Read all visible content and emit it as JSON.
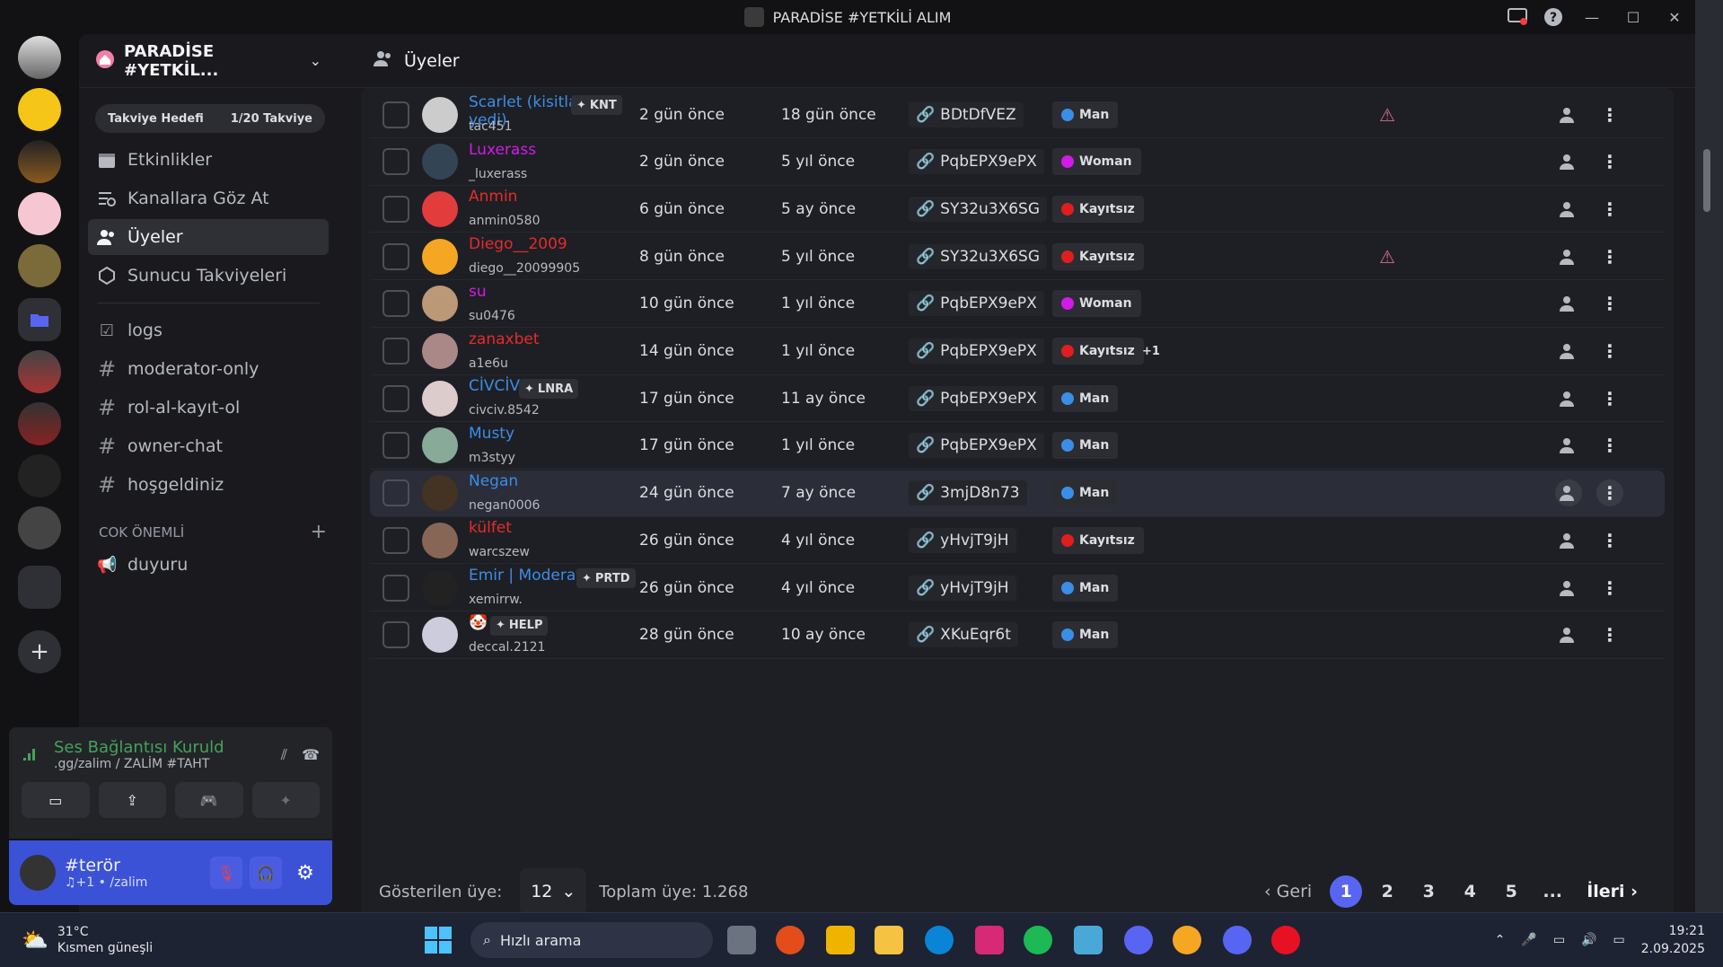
{
  "window": {
    "title": "PARADİSE #YETKİLİ ALIM"
  },
  "server": {
    "name": "PARADİSE #YETKİL...",
    "boost_label": "Takviye Hedefi",
    "boost_count": "1/20 Takviye"
  },
  "nav": [
    {
      "label": "Etkinlikler",
      "icon": "calendar-icon"
    },
    {
      "label": "Kanallara Göz At",
      "icon": "browse-channels-icon"
    },
    {
      "label": "Üyeler",
      "icon": "members-icon"
    },
    {
      "label": "Sunucu Takviyeleri",
      "icon": "boost-icon"
    }
  ],
  "channels": [
    "logs",
    "moderator-only",
    "rol-al-kayıt-ol",
    "owner-chat",
    "hoşgeldiniz"
  ],
  "category": {
    "name": "COK ÖNEMLİ",
    "channels": [
      "duyuru"
    ]
  },
  "voice": {
    "status": "Ses Bağlantısı Kuruld",
    "server": ".gg/zalim / ZALİM #TAHT"
  },
  "user": {
    "name": "#terör",
    "status": "♫+1 • /zalim"
  },
  "main": {
    "title": "Üyeler"
  },
  "members": [
    {
      "name": "Scarlet (kisitlama yedi)",
      "username": "tac451",
      "tag": "KNT",
      "joined": "2 gün önce",
      "created": "18 gün önce",
      "invite": "BDtDfVEZ",
      "role": "Man",
      "role_color": "#3b8ee6",
      "name_color": "#3b8ee6",
      "flag": true
    },
    {
      "name": "Luxerass",
      "username": "_luxerass",
      "tag": "",
      "joined": "2 gün önce",
      "created": "5 yıl önce",
      "invite": "PqbEPX9ePX",
      "role": "Woman",
      "role_color": "#d11be6",
      "name_color": "#d11be6",
      "flag": false
    },
    {
      "name": "Anmin",
      "username": "anmin0580",
      "tag": "",
      "joined": "6 gün önce",
      "created": "5 ay önce",
      "invite": "SY32u3X6SG",
      "role": "Kayıtsız",
      "role_color": "#e01e1e",
      "name_color": "#e52b2b",
      "flag": false
    },
    {
      "name": "Diego__2009",
      "username": "diego__20099905",
      "tag": "",
      "joined": "8 gün önce",
      "created": "5 yıl önce",
      "invite": "SY32u3X6SG",
      "role": "Kayıtsız",
      "role_color": "#e01e1e",
      "name_color": "#e52b2b",
      "flag": true
    },
    {
      "name": "su",
      "username": "su0476",
      "tag": "",
      "joined": "10 gün önce",
      "created": "1 yıl önce",
      "invite": "PqbEPX9ePX",
      "role": "Woman",
      "role_color": "#d11be6",
      "name_color": "#d11be6",
      "flag": false
    },
    {
      "name": "zanaxbet",
      "username": "a1e6u",
      "tag": "",
      "joined": "14 gün önce",
      "created": "1 yıl önce",
      "invite": "PqbEPX9ePX",
      "role": "Kayıtsız",
      "role_color": "#e01e1e",
      "name_color": "#e52b2b",
      "flag": false,
      "extra": "+1"
    },
    {
      "name": "CİVCİV",
      "username": "civciv.8542",
      "tag": "LNRA",
      "joined": "17 gün önce",
      "created": "11 ay önce",
      "invite": "PqbEPX9ePX",
      "role": "Man",
      "role_color": "#3b8ee6",
      "name_color": "#3b8ee6",
      "flag": false
    },
    {
      "name": "Musty",
      "username": "m3styy",
      "tag": "",
      "joined": "17 gün önce",
      "created": "1 yıl önce",
      "invite": "PqbEPX9ePX",
      "role": "Man",
      "role_color": "#3b8ee6",
      "name_color": "#3b8ee6",
      "flag": false
    },
    {
      "name": "Negan",
      "username": "negan0006",
      "tag": "",
      "joined": "24 gün önce",
      "created": "7 ay önce",
      "invite": "3mjD8n73",
      "role": "Man",
      "role_color": "#3b8ee6",
      "name_color": "#3b8ee6",
      "flag": false
    },
    {
      "name": "külfet",
      "username": "warcszew",
      "tag": "",
      "joined": "26 gün önce",
      "created": "4 yıl önce",
      "invite": "yHvjT9jH",
      "role": "Kayıtsız",
      "role_color": "#e01e1e",
      "name_color": "#e52b2b",
      "flag": false
    },
    {
      "name": "Emir | Moderatör",
      "username": "xemirrw.",
      "tag": "PRTD",
      "joined": "26 gün önce",
      "created": "4 yıl önce",
      "invite": "yHvjT9jH",
      "role": "Man",
      "role_color": "#3b8ee6",
      "name_color": "#3b8ee6",
      "flag": false
    },
    {
      "name": "🤡",
      "username": "deccal.2121",
      "tag": "HELP",
      "joined": "28 gün önce",
      "created": "10 ay önce",
      "invite": "XKuEqr6t",
      "role": "Man",
      "role_color": "#3b8ee6",
      "name_color": "#3b8ee6",
      "flag": false
    }
  ],
  "footer": {
    "shown_label": "Gösterilen üye:",
    "shown_value": "12",
    "total": "Toplam üye: 1.268",
    "prev": "Geri",
    "next": "İleri",
    "pages": [
      "1",
      "2",
      "3",
      "4",
      "5",
      "..."
    ]
  },
  "taskbar": {
    "temp": "31°C",
    "weather": "Kısmen güneşli",
    "search": "Hızlı arama",
    "time": "19:21",
    "date": "2.09.2025"
  }
}
